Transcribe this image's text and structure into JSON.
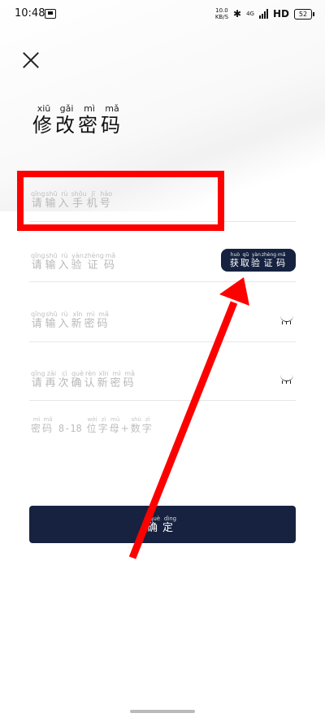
{
  "status_bar": {
    "time": "10:48",
    "net_speed_value": "10.0",
    "net_speed_unit": "KB/S",
    "network_type": "4G",
    "hd": "HD",
    "battery": "52"
  },
  "title": {
    "chars": [
      "修",
      "改",
      "密",
      "码"
    ],
    "pinyin": [
      "xiū",
      "gǎi",
      "mì",
      "mǎ"
    ]
  },
  "phone_field": {
    "chars": [
      "请",
      "输",
      "入",
      "手",
      "机",
      "号"
    ],
    "pinyin": [
      "qǐng",
      "shū",
      "rù",
      "shǒu",
      "jī",
      "hào"
    ]
  },
  "code_field": {
    "chars": [
      "请",
      "输",
      "入",
      "验",
      "证",
      "码"
    ],
    "pinyin": [
      "qǐng",
      "shū",
      "rù",
      "yàn",
      "zhèng",
      "mǎ"
    ]
  },
  "get_code_button": {
    "chars": [
      "获",
      "取",
      "验",
      "证",
      "码"
    ],
    "pinyin": [
      "huò",
      "qǔ",
      "yàn",
      "zhèng",
      "mǎ"
    ]
  },
  "new_password_field": {
    "chars": [
      "请",
      "输",
      "入",
      "新",
      "密",
      "码"
    ],
    "pinyin": [
      "qǐng",
      "shū",
      "rù",
      "xīn",
      "mì",
      "mǎ"
    ]
  },
  "confirm_password_field": {
    "chars": [
      "请",
      "再",
      "次",
      "确",
      "认",
      "新",
      "密",
      "码"
    ],
    "pinyin": [
      "qǐng",
      "zài",
      "cì",
      "què",
      "rèn",
      "xīn",
      "mì",
      "mǎ"
    ]
  },
  "hint": {
    "c1": "密",
    "p1": "mì",
    "c2": "码",
    "p2": "mǎ",
    "range": "8-18",
    "c3": "位",
    "p3": "wèi",
    "c4": "字",
    "p4": "zì",
    "c5": "母",
    "p5": "mǔ",
    "plus": "+",
    "c6": "数",
    "p6": "shù",
    "c7": "字",
    "p7": "zì"
  },
  "confirm_button": {
    "chars": [
      "确",
      "定"
    ],
    "pinyin": [
      "què",
      "dìng"
    ]
  },
  "colors": {
    "primary": "#16223f",
    "annotation": "#ff0000",
    "placeholder": "#b8b8b8"
  }
}
